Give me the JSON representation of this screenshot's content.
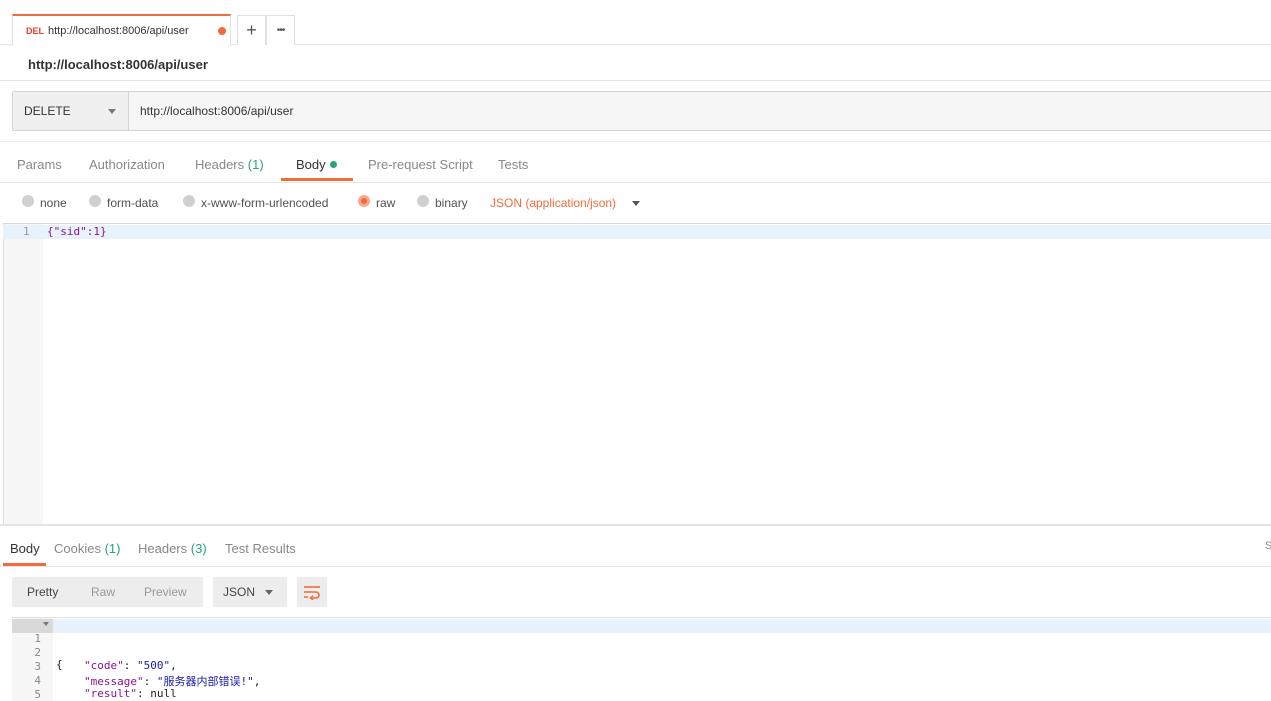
{
  "tab": {
    "method": "DEL",
    "url": "http://localhost:8006/api/user"
  },
  "tab_buttons": {
    "add": "+",
    "more": "•••"
  },
  "request": {
    "title": "http://localhost:8006/api/user",
    "method": "DELETE",
    "url": "http://localhost:8006/api/user"
  },
  "request_tabs": {
    "params": "Params",
    "authorization": "Authorization",
    "headers": "Headers",
    "headers_count": "(1)",
    "body": "Body",
    "prerequest": "Pre-request Script",
    "tests": "Tests"
  },
  "body_types": {
    "none": "none",
    "form_data": "form-data",
    "urlencoded": "x-www-form-urlencoded",
    "raw": "raw",
    "binary": "binary",
    "selected": "raw",
    "content_type": "JSON (application/json)"
  },
  "editor": {
    "line": "1",
    "code": "{\"sid\":1}"
  },
  "response_tabs": {
    "body": "Body",
    "cookies": "Cookies",
    "cookies_count": "(1)",
    "headers": "Headers",
    "headers_count": "(3)",
    "tests": "Test Results",
    "edge_char": "S"
  },
  "response_toolbar": {
    "pretty": "Pretty",
    "raw": "Raw",
    "preview": "Preview",
    "format": "JSON"
  },
  "response_body": {
    "lines": [
      "1",
      "2",
      "3",
      "4",
      "5"
    ],
    "open_brace": "{",
    "close_brace": "}",
    "code_key": "\"code\"",
    "code_val": "\"500\"",
    "message_key": "\"message\"",
    "message_val": "\"服务器内部错误!\"",
    "result_key": "\"result\"",
    "result_val": "null"
  },
  "colors": {
    "accent": "#f26b3a",
    "success": "#26a37a",
    "delete": "#e8412f"
  }
}
